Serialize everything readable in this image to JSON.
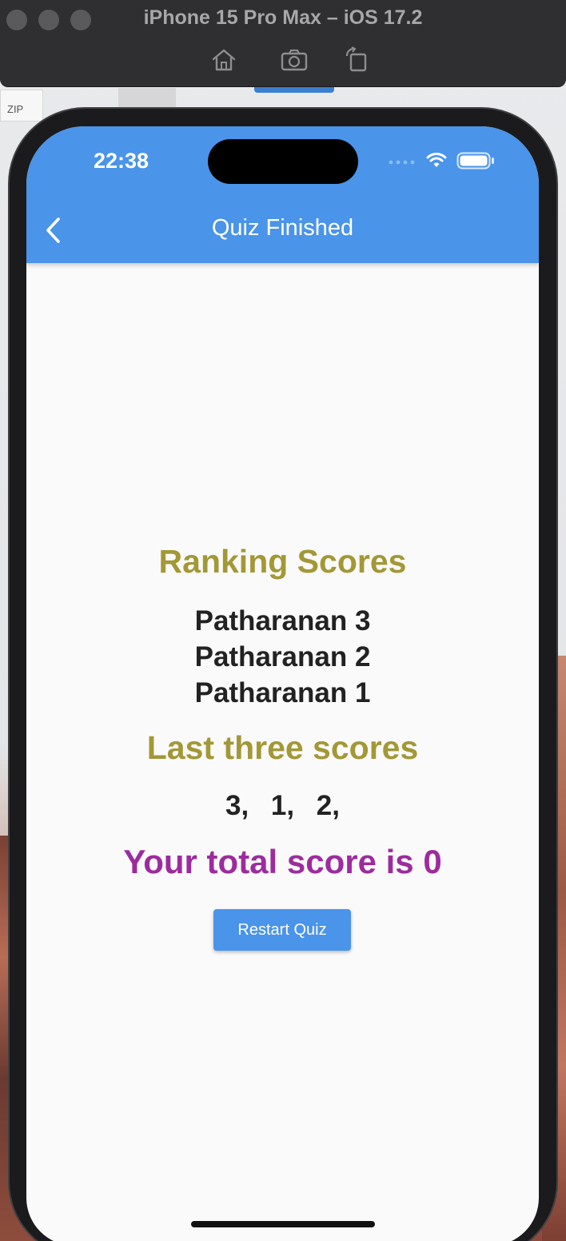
{
  "window": {
    "title": "iPhone 15 Pro Max – iOS 17.2"
  },
  "desktop": {
    "zip_label": "ZIP"
  },
  "status_bar": {
    "time": "22:38"
  },
  "app_bar": {
    "title": "Quiz Finished"
  },
  "ranking": {
    "title": "Ranking Scores",
    "items": [
      "Patharanan 3",
      "Patharanan 2",
      "Patharanan 1"
    ]
  },
  "last_scores": {
    "title": "Last three scores",
    "values_text": "3, 1, 2,"
  },
  "total": {
    "text": "Your total score is 0"
  },
  "actions": {
    "restart_label": "Restart Quiz"
  },
  "colors": {
    "accent": "#4a94ea",
    "heading": "#a39837",
    "total": "#9c2c9e"
  }
}
